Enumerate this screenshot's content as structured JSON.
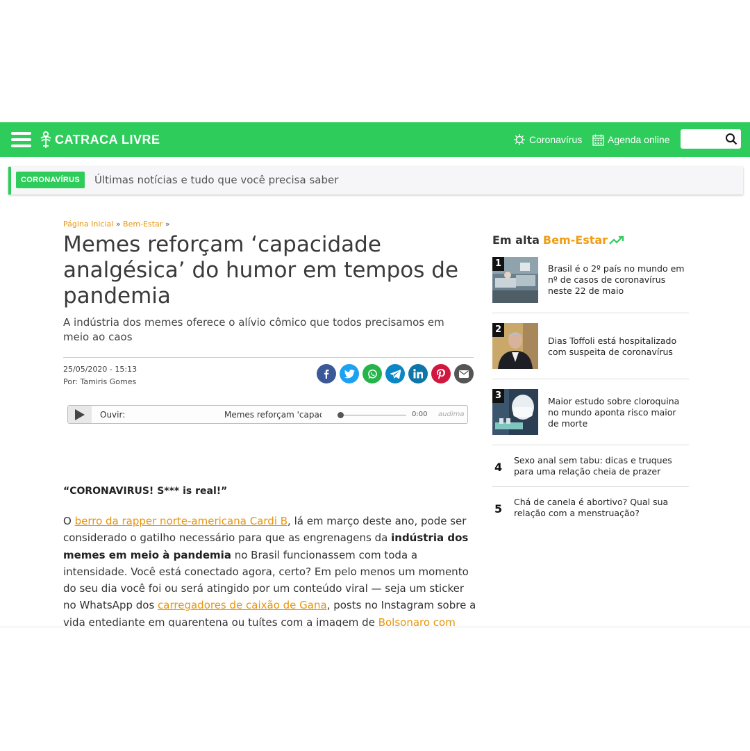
{
  "header": {
    "logo_text": "CATRACA LIVRE",
    "nav_coronavirus": "Coronavírus",
    "nav_agenda": "Agenda online",
    "search_placeholder": "",
    "brand_color": "#2ecc5b"
  },
  "ticker": {
    "badge": "CORONAVÍRUS",
    "text": "Últimas notícias e tudo que você precisa saber"
  },
  "article": {
    "breadcrumb_home": "Página Inicial",
    "breadcrumb_sep": "»",
    "breadcrumb_section": "Bem-Estar",
    "title": "Memes reforçam ‘capacidade analgésica’ do humor em tempos de pandemia",
    "subtitle": "A indústria dos memes oferece o alívio cômico que todos precisamos em meio ao caos",
    "date": "25/05/2020 - 15:13",
    "author": "Por: Tamiris Gomes",
    "share_icons": [
      "facebook-icon",
      "twitter-icon",
      "whatsapp-icon",
      "telegram-icon",
      "linkedin-icon",
      "pinterest-icon",
      "email-icon"
    ],
    "player": {
      "label": "Ouvir:",
      "track_title": "Memes reforçam 'capac",
      "time": "0:00",
      "brand": "audima",
      "progress": 0
    },
    "quote": "“CORONAVIRUS! S*** is real!”",
    "body": {
      "p1_pre": "O ",
      "p1_link1": "berro da rapper norte-americana Cardi B",
      "p1_mid1": ", lá em março deste ano, pode ser considerado o gatilho necessário para que as engrenagens da ",
      "p1_bold": "indústria dos memes em meio à pandemia",
      "p1_mid2": " no Brasil funcionassem com toda a intensidade. Você está conectado agora, certo? Em pelo menos um momento do seu dia você foi ou será atingido por um conteúdo viral — seja um sticker no WhatsApp dos ",
      "p1_link2": "carregadores de caixão de Gana",
      "p1_mid3": ", posts no Instagram sobre a vida entediante em quarentena ou tuítes com a imagem de ",
      "p1_link3": "Bolsonaro com dificuldades em colocar"
    },
    "link_color": "#e8940c"
  },
  "sidebar": {
    "title_prefix": "Em alta",
    "title_accent": "Bem-Estar",
    "accent_color": "#f39c12",
    "items": [
      {
        "num": "1",
        "text": "Brasil é o 2º país no mundo em nº de casos de coronavírus neste 22 de maio"
      },
      {
        "num": "2",
        "text": "Dias Toffoli está hospitalizado com suspeita de coronavírus"
      },
      {
        "num": "3",
        "text": "Maior estudo sobre cloroquina no mundo aponta risco maior de morte"
      },
      {
        "num": "4",
        "text": "Sexo anal sem tabu: dicas e truques para uma relação cheia de prazer"
      },
      {
        "num": "5",
        "text": "Chá de canela é abortivo? Qual sua relação com a menstruação?"
      }
    ]
  }
}
